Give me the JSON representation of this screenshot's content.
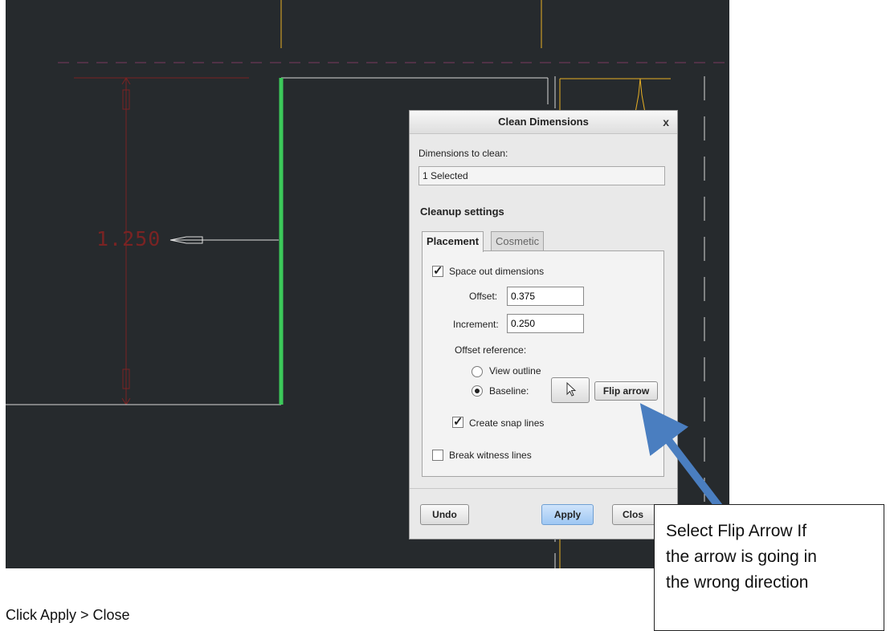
{
  "viewport": {
    "dimension_value": "1.250",
    "colors": {
      "background": "#262a2d",
      "selected_edge": "#3cc95a",
      "dimension": "#7a2323",
      "reference": "#e8b025"
    }
  },
  "dialog": {
    "title": "Clean Dimensions",
    "close_glyph": "x",
    "dims_label": "Dimensions to clean:",
    "dims_value": "1 Selected",
    "section_title": "Cleanup settings",
    "tabs": [
      {
        "label": "Placement",
        "active": true
      },
      {
        "label": "Cosmetic",
        "active": false
      }
    ],
    "space_out": {
      "label": "Space out dimensions",
      "checked": true
    },
    "offset": {
      "label": "Offset:",
      "value": "0.375"
    },
    "increment": {
      "label": "Increment:",
      "value": "0.250"
    },
    "offset_reference": {
      "label": "Offset reference:"
    },
    "view_outline": {
      "label": "View outline",
      "selected": false
    },
    "baseline": {
      "label": "Baseline:",
      "selected": true
    },
    "select_icon": "cursor-arrow-icon",
    "flip_arrow": "Flip arrow",
    "snap_lines": {
      "label": "Create snap lines",
      "checked": true
    },
    "break_witness": {
      "label": "Break witness lines",
      "checked": false
    },
    "undo": "Undo",
    "apply": "Apply",
    "close": "Clos"
  },
  "callout": {
    "line1": "Select Flip Arrow If",
    "line2": "the arrow is going in",
    "line3": "the wrong direction"
  },
  "caption": "Click Apply > Close",
  "arrow_color": "#4a7ec0"
}
